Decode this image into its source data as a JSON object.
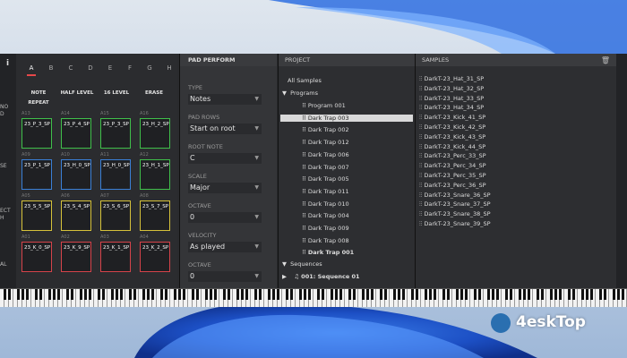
{
  "left_strip": {
    "info": "i",
    "labels": [
      "NO",
      "D",
      "SE",
      "ECT",
      "H",
      "AL"
    ]
  },
  "pads": {
    "banks": [
      "A",
      "B",
      "C",
      "D",
      "E",
      "F",
      "G",
      "H"
    ],
    "active_bank": "A",
    "actions": [
      "NOTE REPEAT",
      "HALF LEVEL",
      "16 LEVEL",
      "ERASE"
    ],
    "rows": [
      [
        {
          "num": "A13",
          "name": "23_P_3_SP",
          "color": "#3fbf4a"
        },
        {
          "num": "A14",
          "name": "23_P_4_SP",
          "color": "#3fbf4a"
        },
        {
          "num": "A15",
          "name": "23_P_3_SP",
          "color": "#3fbf4a"
        },
        {
          "num": "A16",
          "name": "23_H_2_SP",
          "color": "#3fbf4a"
        }
      ],
      [
        {
          "num": "A09",
          "name": "23_P_1_SP",
          "color": "#3a7fd6"
        },
        {
          "num": "A10",
          "name": "23_H_0_SP",
          "color": "#3a7fd6"
        },
        {
          "num": "A11",
          "name": "23_H_0_SP",
          "color": "#3a7fd6"
        },
        {
          "num": "A12",
          "name": "23_H_1_SP",
          "color": "#3fbf4a"
        }
      ],
      [
        {
          "num": "A05",
          "name": "23_S_5_SP",
          "color": "#d6c23a"
        },
        {
          "num": "A06",
          "name": "23_S_4_SP",
          "color": "#d6c23a"
        },
        {
          "num": "A07",
          "name": "23_S_6_SP",
          "color": "#d6c23a"
        },
        {
          "num": "A08",
          "name": "23_S_7_SP",
          "color": "#d6c23a"
        }
      ],
      [
        {
          "num": "A01",
          "name": "23_K_0_SP",
          "color": "#d6434a"
        },
        {
          "num": "A02",
          "name": "23_K_9_SP",
          "color": "#d6434a"
        },
        {
          "num": "A03",
          "name": "23_K_1_SP",
          "color": "#d6434a"
        },
        {
          "num": "A04",
          "name": "23_K_2_SP",
          "color": "#d6434a"
        }
      ]
    ]
  },
  "perform": {
    "title": "PAD PERFORM",
    "fields": [
      {
        "label": "TYPE",
        "value": "Notes"
      },
      {
        "label": "PAD ROWS",
        "value": "Start on root"
      },
      {
        "label": "ROOT NOTE",
        "value": "C"
      },
      {
        "label": "SCALE",
        "value": "Major"
      },
      {
        "label": "OCTAVE",
        "value": "0"
      },
      {
        "label": "VELOCITY",
        "value": "As played"
      },
      {
        "label": "OCTAVE",
        "value": "0"
      }
    ]
  },
  "project": {
    "title": "PROJECT",
    "all_samples": "All Samples",
    "programs_label": "Programs",
    "programs": [
      "Program 001",
      "Dark Trap 003",
      "Dark Trap 002",
      "Dark Trap 012",
      "Dark Trap 006",
      "Dark Trap 007",
      "Dark Trap 005",
      "Dark Trap 011",
      "Dark Trap 010",
      "Dark Trap 004",
      "Dark Trap 009",
      "Dark Trap 008",
      "Dark Trap 001"
    ],
    "selected_program": "Dark Trap 003",
    "sequences_label": "Sequences",
    "sequence": "001: Sequence 01"
  },
  "samples": {
    "title": "SAMPLES",
    "items": [
      "DarkT-23_Hat_31_SP",
      "DarkT-23_Hat_32_SP",
      "DarkT-23_Hat_33_SP",
      "DarkT-23_Hat_34_SP",
      "DarkT-23_Kick_41_SP",
      "DarkT-23_Kick_42_SP",
      "DarkT-23_Kick_43_SP",
      "DarkT-23_Kick_44_SP",
      "DarkT-23_Perc_33_SP",
      "DarkT-23_Perc_34_SP",
      "DarkT-23_Perc_35_SP",
      "DarkT-23_Perc_36_SP",
      "DarkT-23_Snare_36_SP",
      "DarkT-23_Snare_37_SP",
      "DarkT-23_Snare_38_SP",
      "DarkT-23_Snare_39_SP"
    ]
  },
  "watermark": {
    "text": "4eskTop"
  },
  "colors": {
    "accent": "#e6484a",
    "selected_row": "#d9d9d9"
  }
}
